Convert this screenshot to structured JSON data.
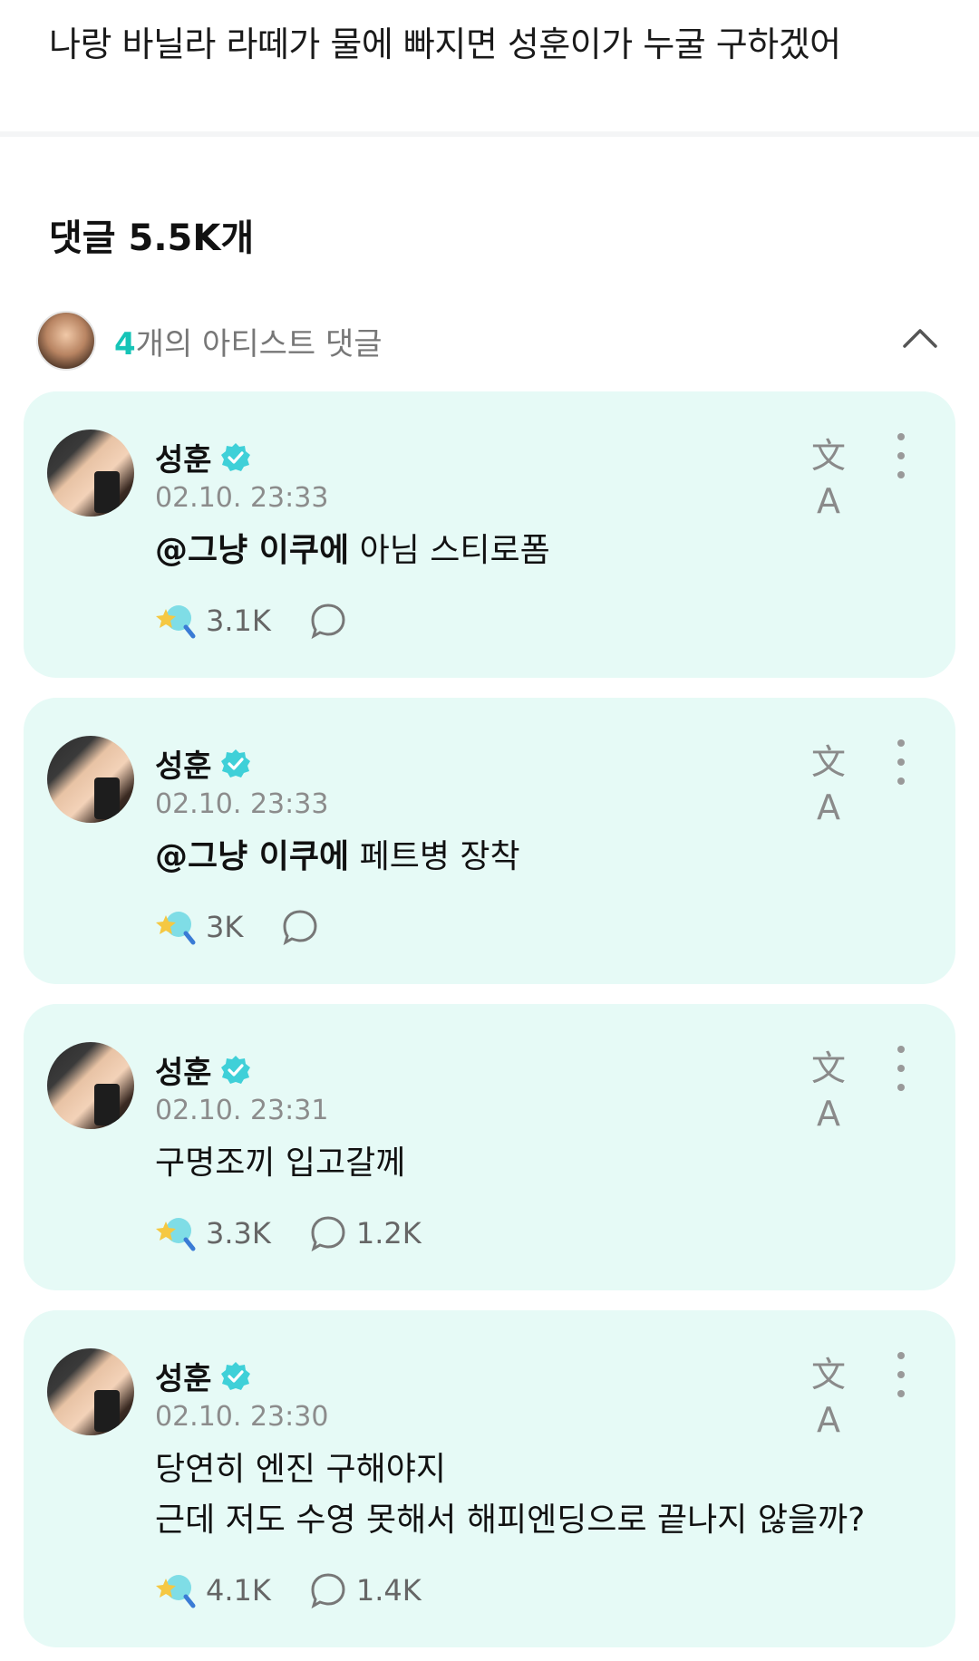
{
  "post": {
    "text": "나랑 바닐라 라떼가 물에 빠지면 성훈이가 누굴 구하겠어"
  },
  "comments_header": {
    "title": "댓글 5.5K개"
  },
  "artist_comments": {
    "count": "4",
    "label": "개의 아티스트 댓글"
  },
  "icons": {
    "collapse": "chevron-up-icon",
    "verified": "verified-badge-icon",
    "translate": "translate-icon",
    "more": "more-vertical-icon",
    "like": "star-magnifier-like-icon",
    "reply": "chat-bubble-icon"
  },
  "colors": {
    "accent": "#16c4b7",
    "card_bg": "#e6faf6",
    "verified": "#3fd0d8"
  },
  "comments": [
    {
      "author": "성훈",
      "timestamp": "02.10. 23:33",
      "mention": "@그냥 이쿠에",
      "text": " 아님 스티로폼",
      "likes": "3.1K",
      "replies": "",
      "translate_glyph": "文A"
    },
    {
      "author": "성훈",
      "timestamp": "02.10. 23:33",
      "mention": "@그냥 이쿠에",
      "text": " 페트병 장착",
      "likes": "3K",
      "replies": "",
      "translate_glyph": "文A"
    },
    {
      "author": "성훈",
      "timestamp": "02.10. 23:31",
      "mention": "",
      "text": "구명조끼 입고갈께",
      "likes": "3.3K",
      "replies": "1.2K",
      "translate_glyph": "文A"
    },
    {
      "author": "성훈",
      "timestamp": "02.10. 23:30",
      "mention": "",
      "text": "당연히 엔진 구해야지",
      "text_line2": "근데 저도 수영 못해서 해피엔딩으로 끝나지 않을까?",
      "likes": "4.1K",
      "replies": "1.4K",
      "translate_glyph": "文A"
    }
  ]
}
